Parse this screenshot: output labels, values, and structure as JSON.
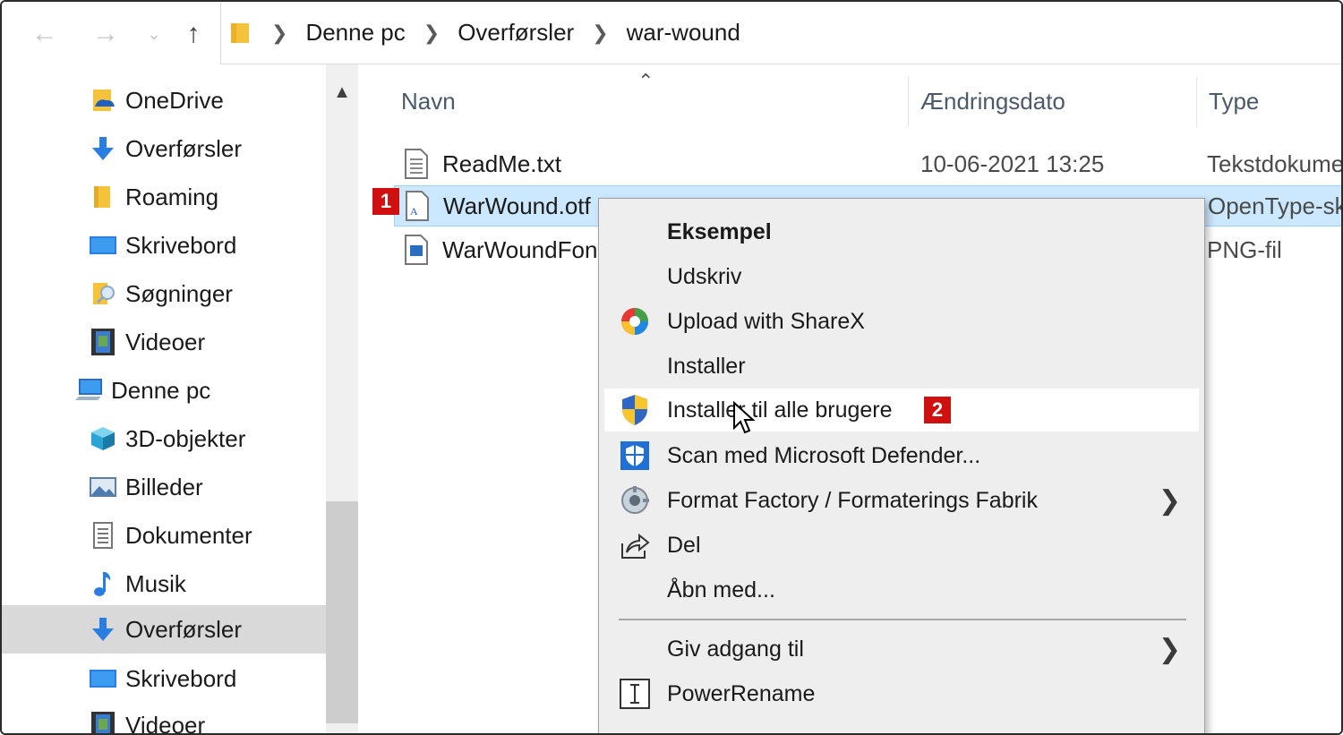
{
  "breadcrumb": [
    "Denne pc",
    "Overførsler",
    "war-wound"
  ],
  "sidebar": {
    "items": [
      {
        "label": "OneDrive",
        "icon": "onedrive-icon"
      },
      {
        "label": "Overførsler",
        "icon": "download-arrow-icon"
      },
      {
        "label": "Roaming",
        "icon": "folder-icon"
      },
      {
        "label": "Skrivebord",
        "icon": "desktop-icon"
      },
      {
        "label": "Søgninger",
        "icon": "search-folder-icon"
      },
      {
        "label": "Videoer",
        "icon": "film-icon"
      },
      {
        "label": "Denne pc",
        "icon": "computer-icon"
      },
      {
        "label": "3D-objekter",
        "icon": "cube-icon"
      },
      {
        "label": "Billeder",
        "icon": "pictures-icon"
      },
      {
        "label": "Dokumenter",
        "icon": "document-icon"
      },
      {
        "label": "Musik",
        "icon": "music-note-icon"
      },
      {
        "label": "Overførsler",
        "icon": "download-arrow-icon"
      },
      {
        "label": "Skrivebord",
        "icon": "desktop-icon"
      },
      {
        "label": "Videoer",
        "icon": "film-icon"
      }
    ],
    "selected_index": 11
  },
  "columns": {
    "name": "Navn",
    "date": "Ændringsdato",
    "type": "Type"
  },
  "files": [
    {
      "name": "ReadMe.txt",
      "date": "10-06-2021 13:25",
      "type": "Tekstdokume",
      "icon": "text-file-icon"
    },
    {
      "name": "WarWound.otf",
      "date": "",
      "type": "OpenType-sk",
      "icon": "font-file-icon"
    },
    {
      "name": "WarWoundFon",
      "date": "",
      "type": "PNG-fil",
      "icon": "image-file-icon"
    }
  ],
  "badges": {
    "first": "1",
    "second": "2"
  },
  "context_menu": {
    "items": [
      {
        "label": "Eksempel",
        "bold": true,
        "icon": ""
      },
      {
        "label": "Udskriv",
        "icon": ""
      },
      {
        "label": "Upload with ShareX",
        "icon": "sharex-icon"
      },
      {
        "label": "Installer",
        "icon": ""
      },
      {
        "label": "Installer til alle brugere",
        "icon": "uac-shield-icon"
      },
      {
        "label": "Scan med Microsoft Defender...",
        "icon": "defender-shield-icon"
      },
      {
        "label": "Format Factory / Formaterings Fabrik",
        "icon": "format-factory-icon",
        "submenu": true
      },
      {
        "label": "Del",
        "icon": "share-icon"
      },
      {
        "label": "Åbn med...",
        "icon": ""
      },
      {
        "label": "Giv adgang til",
        "icon": "",
        "submenu": true
      },
      {
        "label": "PowerRename",
        "icon": "powerrename-icon"
      }
    ],
    "hover_index": 4
  },
  "colors": {
    "selection": "#cce8ff",
    "badge": "#d01010",
    "menu_bg": "#eeeeee"
  }
}
